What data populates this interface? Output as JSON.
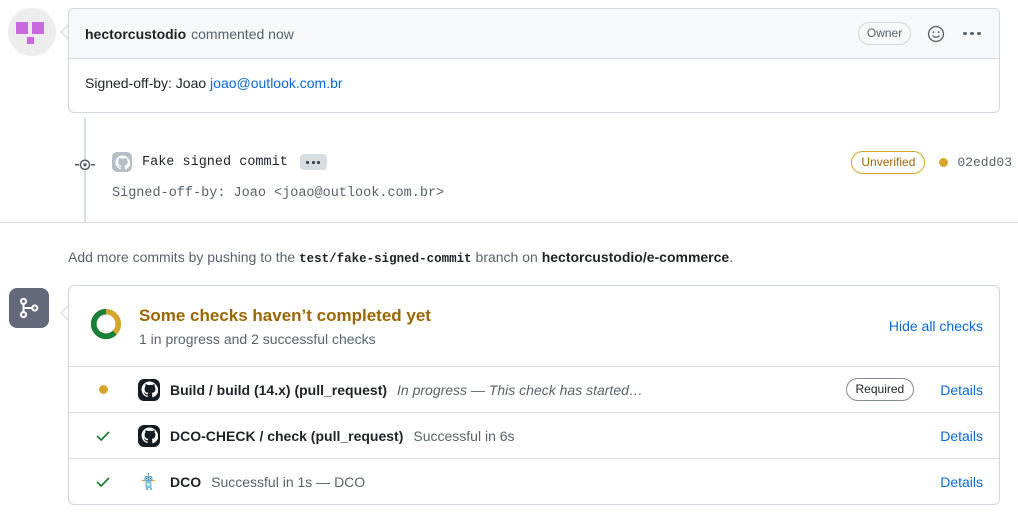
{
  "comment": {
    "author": "hectorcustodio",
    "meta": "commented now",
    "owner_badge": "Owner",
    "body_prefix": "Signed-off-by: Joao ",
    "body_link": "joao@outlook.com.br",
    "icons": {
      "emoji": "smiley-icon",
      "kebab": "kebab-horizontal-icon",
      "avatar": "user-avatar"
    }
  },
  "commit": {
    "message": "Fake signed commit",
    "expand_label": "...",
    "verification_badge": "Unverified",
    "sha": "02edd03",
    "signoff": "Signed-off-by: Joao <joao@outlook.com.br>",
    "dot_color": "#d4a72c",
    "badge_color": "#9a6700"
  },
  "add_more": {
    "lead": "Add more commits by pushing to the ",
    "branch": "test/fake-signed-commit",
    "mid": " branch on ",
    "repo": "hectorcustodio/e-commerce",
    "tail": "."
  },
  "checks": {
    "title": "Some checks haven’t completed yet",
    "subtitle": "1 in progress and 2 successful checks",
    "hide_all_label": "Hide all checks",
    "merge_icon": "git-merge-icon",
    "donut": {
      "green_color": "#1a7f37",
      "yellow_color": "#d4a72c",
      "green_fraction": 0.66
    },
    "rows": [
      {
        "status": "in-progress",
        "status_icon": "amber-dot-icon",
        "avatar": "github-actions-icon",
        "name": "Build / build (14.x) (pull_request)",
        "description": "In progress — This check has started…",
        "description_italic": true,
        "required_badge": "Required",
        "details_label": "Details"
      },
      {
        "status": "success",
        "status_icon": "check-mark-icon",
        "avatar": "github-actions-icon",
        "name": "DCO-CHECK / check (pull_request)",
        "description": "Successful in 6s",
        "description_italic": false,
        "required_badge": null,
        "details_label": "Details"
      },
      {
        "status": "success",
        "status_icon": "check-mark-icon",
        "avatar": "probot-bot-icon",
        "name": "DCO",
        "description": "Successful in 1s — DCO",
        "description_italic": false,
        "required_badge": null,
        "details_label": "Details"
      }
    ]
  },
  "colors": {
    "link": "#0969da",
    "muted": "#59636e",
    "text": "#1f2328",
    "border": "#d0d7de",
    "success": "#1a7f37",
    "attention": "#d4a72c"
  }
}
